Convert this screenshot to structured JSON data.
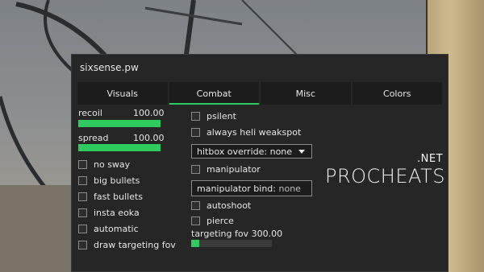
{
  "window": {
    "title": "sixsense.pw"
  },
  "tabs": [
    {
      "label": "Visuals",
      "active": false
    },
    {
      "label": "Combat",
      "active": true
    },
    {
      "label": "Misc",
      "active": false
    },
    {
      "label": "Colors",
      "active": false
    }
  ],
  "sliders": {
    "recoil": {
      "label": "recoil",
      "value": "100.00",
      "fraction": 1.0
    },
    "spread": {
      "label": "spread",
      "value": "100.00",
      "fraction": 1.0
    },
    "targeting_fov": {
      "label": "targeting fov",
      "value": "300.00",
      "fraction": 0.1
    }
  },
  "left_checkboxes": [
    {
      "label": "no sway",
      "checked": false
    },
    {
      "label": "big bullets",
      "checked": false
    },
    {
      "label": "fast bullets",
      "checked": false
    },
    {
      "label": "insta eoka",
      "checked": false
    },
    {
      "label": "automatic",
      "checked": false
    },
    {
      "label": "draw targeting fov",
      "checked": false
    }
  ],
  "right": {
    "psilent": {
      "label": "psilent",
      "checked": false
    },
    "always_heli_weakspot": {
      "label": "always heli weakspot",
      "checked": false
    },
    "hitbox_override": {
      "label": "hitbox override:",
      "value": "none"
    },
    "manipulator": {
      "label": "manipulator",
      "checked": false
    },
    "manipulator_bind": {
      "label": "manipulator bind:",
      "value": "none"
    },
    "autoshoot": {
      "label": "autoshoot",
      "checked": false
    },
    "pierce": {
      "label": "pierce",
      "checked": false
    }
  },
  "watermark": {
    "net": ".NET",
    "brand": "PROCHEATS"
  },
  "colors": {
    "accent": "#2ecc5c",
    "panel": "#262626"
  }
}
